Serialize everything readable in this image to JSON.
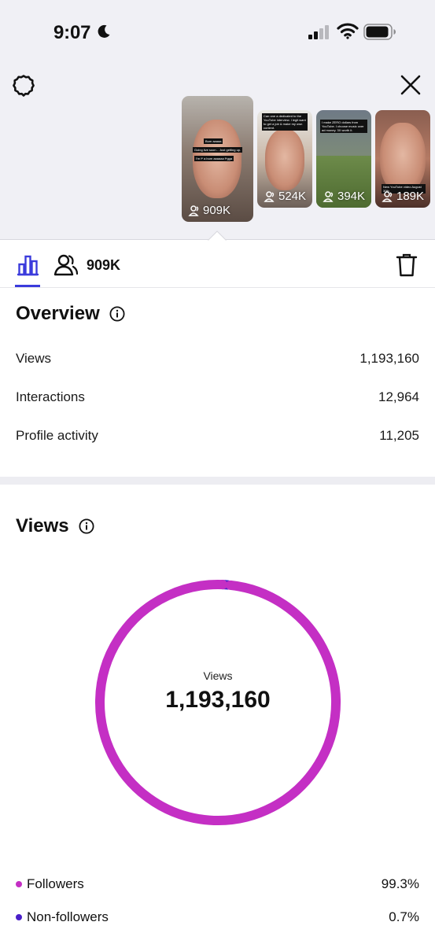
{
  "status_bar": {
    "time": "9:07",
    "icons": [
      "moon-icon",
      "cellular-signal-icon",
      "wifi-icon",
      "battery-icon"
    ]
  },
  "header": {
    "left_icon": "gear-icon",
    "right_icon": "close-icon"
  },
  "thumbnails": [
    {
      "views": "909K",
      "captions": [
        "Bum aaaaa",
        "Going live soon... Just getting up.",
        "I'm f* a bum aaaaaa f*gga"
      ],
      "selected": true
    },
    {
      "views": "524K",
      "captions": [
        "Can one a dedicated to the YouTube interview. I legit want to get a job & make my own content."
      ]
    },
    {
      "views": "394K",
      "captions": [
        "I make ZERO dollars from YouTube. I choose music over ad money. 3X worth it."
      ]
    },
    {
      "views": "189K",
      "captions": [
        "New YouTube video August 30th"
      ]
    }
  ],
  "tabs": {
    "insights_icon": "bar-chart-icon",
    "reach_icon": "people-icon",
    "reach_value": "909K",
    "delete_icon": "trash-icon"
  },
  "overview": {
    "title": "Overview",
    "rows": [
      {
        "label": "Views",
        "value": "1,193,160"
      },
      {
        "label": "Interactions",
        "value": "12,964"
      },
      {
        "label": "Profile activity",
        "value": "11,205"
      }
    ]
  },
  "views_section": {
    "title": "Views",
    "center_label": "Views",
    "center_value": "1,193,160"
  },
  "chart_data": {
    "type": "pie",
    "categories": [
      "Followers",
      "Non-followers"
    ],
    "values": [
      99.3,
      0.7
    ],
    "labels": [
      "99.3%",
      "0.7%"
    ],
    "colors": [
      "#c42fc4",
      "#4a1fc9"
    ]
  },
  "colors": {
    "accent": "#3b3bdc",
    "followers": "#c42fc4",
    "non_followers": "#4a1fc9"
  }
}
